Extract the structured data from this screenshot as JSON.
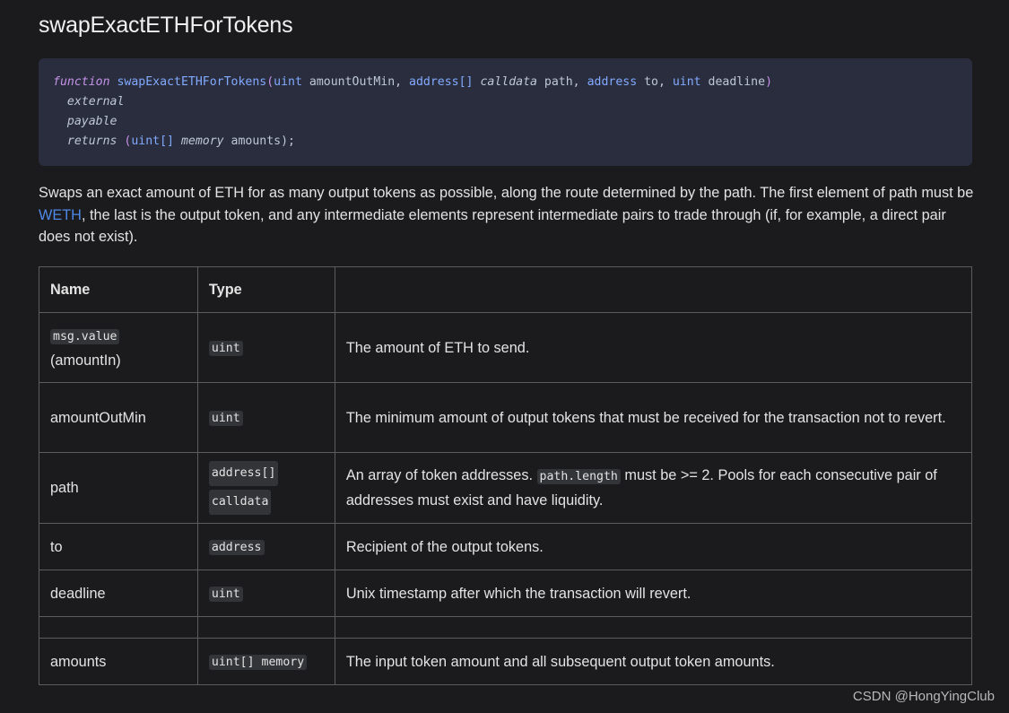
{
  "title": "swapExactETHForTokens",
  "code": {
    "kw_function": "function",
    "fn_name": "swapExactETHForTokens",
    "open_paren": "(",
    "t_uint1": "uint",
    "p_amountOutMin": " amountOutMin, ",
    "t_address_arr": "address[]",
    "kw_calldata": "calldata",
    "p_path": " path, ",
    "t_address": "address",
    "p_to": " to, ",
    "t_uint2": "uint",
    "p_deadline": " deadline",
    "close_paren": ")",
    "kw_external": "external",
    "kw_payable": "payable",
    "kw_returns": "returns",
    "ret_open": " (",
    "t_uint_arr": "uint[]",
    "kw_memory": "memory",
    "ret_rest": " amounts);"
  },
  "description": {
    "before_link": "Swaps an exact amount of ETH for as many output tokens as possible, along the route determined by the path. The first element of path must be ",
    "link": "WETH",
    "after_link": ", the last is the output token, and any intermediate elements represent intermediate pairs to trade through (if, for example, a direct pair does not exist)."
  },
  "table": {
    "headers": [
      "Name",
      "Type",
      ""
    ],
    "rows": [
      {
        "name_code": "msg.value",
        "name_text": "(amountIn)",
        "type": "uint",
        "desc": "The amount of ETH to send."
      },
      {
        "name": "amountOutMin",
        "type": "uint",
        "desc": "The minimum amount of output tokens that must be received for the transaction not to revert."
      },
      {
        "name": "path",
        "type_a": "address[]",
        "type_b": "calldata",
        "desc_before": "An array of token addresses. ",
        "desc_code": "path.length",
        "desc_after": " must be >= 2. Pools for each consecutive pair of addresses must exist and have liquidity."
      },
      {
        "name": "to",
        "type": "address",
        "desc": "Recipient of the output tokens."
      },
      {
        "name": "deadline",
        "type": "uint",
        "desc": "Unix timestamp after which the transaction will revert."
      },
      {
        "name": "",
        "type": "",
        "desc": ""
      },
      {
        "name": "amounts",
        "type": "uint[] memory",
        "desc": "The input token amount and all subsequent output token amounts."
      }
    ]
  },
  "watermark": "CSDN @HongYingClub"
}
